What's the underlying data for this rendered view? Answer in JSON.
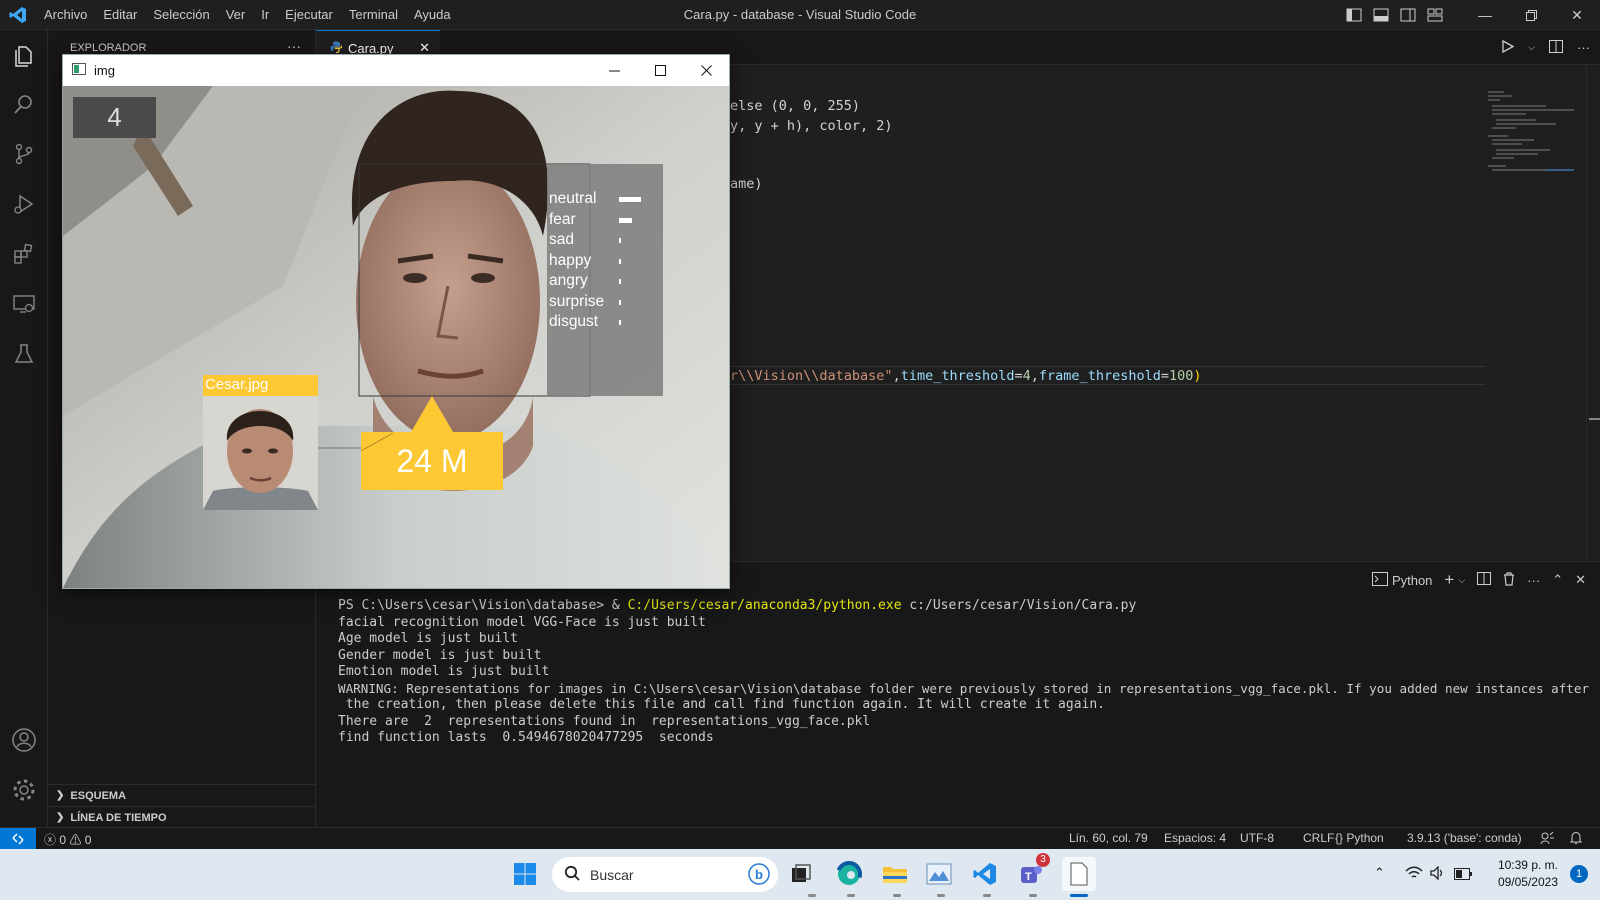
{
  "titlebar": {
    "menu": [
      "Archivo",
      "Editar",
      "Selección",
      "Ver",
      "Ir",
      "Ejecutar",
      "Terminal",
      "Ayuda"
    ],
    "title": "Cara.py - database - Visual Studio Code"
  },
  "sidebar": {
    "title": "EXPLORADOR",
    "sections": [
      "ESQUEMA",
      "LÍNEA DE TIEMPO"
    ]
  },
  "tabs": [
    {
      "label": "Cara.py"
    }
  ],
  "editor": {
    "lines": [
      {
        "text": "else (0, 0, 255)"
      },
      {
        "text": "y, y + h), color, 2)"
      },
      {
        "text": "ame)"
      },
      {
        "path": "r\\\\Vision\\\\database\"",
        "p1": "time_threshold",
        "v1": "4",
        "p2": "frame_threshold",
        "v2": "100"
      }
    ]
  },
  "panel": {
    "shell_label": "Python",
    "terminal": {
      "prompt": "PS C:\\Users\\cesar\\Vision\\database> & ",
      "exe": "C:/Users/cesar/anaconda3/python.exe",
      "script": " c:/Users/cesar/Vision/Cara.py",
      "lines": [
        "facial recognition model VGG-Face is just built",
        "Age model is just built",
        "Gender model is just built",
        "Emotion model is just built",
        "WARNING: Representations for images in C:\\Users\\cesar\\Vision\\database folder were previously stored in representations_vgg_face.pkl. If you added new instances after",
        " the creation, then please delete this file and call find function again. It will create it again.",
        "There are  2  representations found in  representations_vgg_face.pkl",
        "find function lasts  0.5494678020477295  seconds"
      ]
    }
  },
  "statusbar": {
    "errors": "0",
    "warnings": "0",
    "position": "Lín. 60, col. 79",
    "spaces": "Espacios: 4",
    "encoding": "UTF-8",
    "eol": "CRLF",
    "language": "Python",
    "interpreter": "3.9.13 ('base': conda)"
  },
  "cv_window": {
    "title": "img",
    "counter": "4",
    "match_label": "Cesar.jpg",
    "age_gender": "24 M",
    "emotions": [
      {
        "name": "neutral",
        "level": 0.9
      },
      {
        "name": "fear",
        "level": 0.55
      },
      {
        "name": "sad",
        "level": 0.1
      },
      {
        "name": "happy",
        "level": 0.05
      },
      {
        "name": "angry",
        "level": 0.05
      },
      {
        "name": "surprise",
        "level": 0.05
      },
      {
        "name": "disgust",
        "level": 0.05
      }
    ]
  },
  "taskbar": {
    "search_placeholder": "Buscar",
    "teams_badge": "3",
    "time": "10:39 p. m.",
    "date": "09/05/2023",
    "notification_count": "1"
  },
  "colors": {
    "accent": "#0078d4",
    "overlay_yellow": "#fcc935"
  }
}
